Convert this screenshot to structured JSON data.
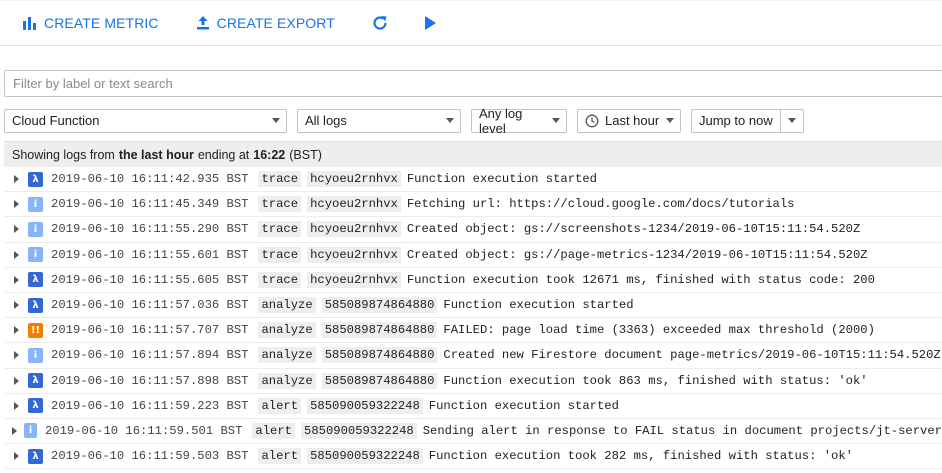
{
  "toolbar": {
    "create_metric_label": "CREATE METRIC",
    "create_export_label": "CREATE EXPORT",
    "accent_color": "#1a73e8"
  },
  "search": {
    "placeholder": "Filter by label or text search",
    "value": ""
  },
  "filters": {
    "resource": "Cloud Function",
    "logs": "All logs",
    "level": "Any log level",
    "time": "Last hour",
    "jump": "Jump to now"
  },
  "banner": {
    "prefix": "Showing logs from",
    "range": "the last hour",
    "middle": "ending at",
    "time": "16:22",
    "suffix": "(BST)"
  },
  "severity_colors": {
    "debug": "#3367d6",
    "info": "#8ab4f8",
    "error": "#f57c00"
  },
  "severity_icons": {
    "debug": "lambda-icon",
    "info": "info-icon",
    "error": "error-icon"
  },
  "logs": [
    {
      "severity": "debug",
      "glyph": "λ",
      "timestamp": "2019-06-10 16:11:42.935 BST",
      "name": "trace",
      "id": "hcyoeu2rnhvx",
      "message": "Function execution started"
    },
    {
      "severity": "info",
      "glyph": "i",
      "timestamp": "2019-06-10 16:11:45.349 BST",
      "name": "trace",
      "id": "hcyoeu2rnhvx",
      "message": "Fetching url: https://cloud.google.com/docs/tutorials"
    },
    {
      "severity": "info",
      "glyph": "i",
      "timestamp": "2019-06-10 16:11:55.290 BST",
      "name": "trace",
      "id": "hcyoeu2rnhvx",
      "message": "Created object: gs://screenshots-1234/2019-06-10T15:11:54.520Z"
    },
    {
      "severity": "info",
      "glyph": "i",
      "timestamp": "2019-06-10 16:11:55.601 BST",
      "name": "trace",
      "id": "hcyoeu2rnhvx",
      "message": "Created object: gs://page-metrics-1234/2019-06-10T15:11:54.520Z"
    },
    {
      "severity": "debug",
      "glyph": "λ",
      "timestamp": "2019-06-10 16:11:55.605 BST",
      "name": "trace",
      "id": "hcyoeu2rnhvx",
      "message": "Function execution took 12671 ms, finished with status code: 200"
    },
    {
      "severity": "debug",
      "glyph": "λ",
      "timestamp": "2019-06-10 16:11:57.036 BST",
      "name": "analyze",
      "id": "585089874864880",
      "message": "Function execution started"
    },
    {
      "severity": "error",
      "glyph": "!!",
      "timestamp": "2019-06-10 16:11:57.707 BST",
      "name": "analyze",
      "id": "585089874864880",
      "message": "FAILED: page load time (3363) exceeded max threshold (2000)"
    },
    {
      "severity": "info",
      "glyph": "i",
      "timestamp": "2019-06-10 16:11:57.894 BST",
      "name": "analyze",
      "id": "585089874864880",
      "message": "Created new Firestore document page-metrics/2019-06-10T15:11:54.520Z"
    },
    {
      "severity": "debug",
      "glyph": "λ",
      "timestamp": "2019-06-10 16:11:57.898 BST",
      "name": "analyze",
      "id": "585089874864880",
      "message": "Function execution took 863 ms, finished with status: 'ok'"
    },
    {
      "severity": "debug",
      "glyph": "λ",
      "timestamp": "2019-06-10 16:11:59.223 BST",
      "name": "alert",
      "id": "585090059322248",
      "message": "Function execution started"
    },
    {
      "severity": "info",
      "glyph": "i",
      "timestamp": "2019-06-10 16:11:59.501 BST",
      "name": "alert",
      "id": "585090059322248",
      "message": "Sending alert in response to FAIL status in document projects/jt-server"
    },
    {
      "severity": "debug",
      "glyph": "λ",
      "timestamp": "2019-06-10 16:11:59.503 BST",
      "name": "alert",
      "id": "585090059322248",
      "message": "Function execution took 282 ms, finished with status: 'ok'"
    }
  ]
}
